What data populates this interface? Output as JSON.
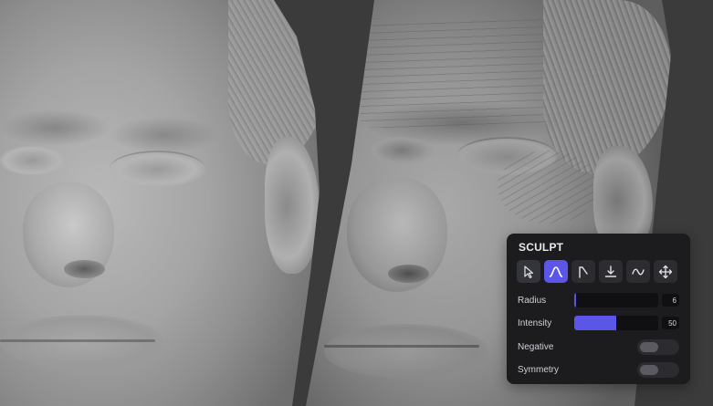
{
  "panel": {
    "title": "SCULPT",
    "tools": [
      {
        "icon": "cursor-icon",
        "active": false
      },
      {
        "icon": "curve-brush-icon",
        "active": true
      },
      {
        "icon": "flag-brush-icon",
        "active": false
      },
      {
        "icon": "flatten-icon",
        "active": false
      },
      {
        "icon": "smooth-wave-icon",
        "active": false
      },
      {
        "icon": "move-icon",
        "active": false
      }
    ],
    "radius": {
      "label": "Radius",
      "value": "6",
      "fill": 0.02
    },
    "intensity": {
      "label": "Intensity",
      "value": "50",
      "fill": 0.5
    },
    "negative": {
      "label": "Negative",
      "on": false
    },
    "symmetry": {
      "label": "Symmetry",
      "on": false
    }
  },
  "colors": {
    "accent": "#5b55e8",
    "panel_bg": "#1c1c1f"
  }
}
